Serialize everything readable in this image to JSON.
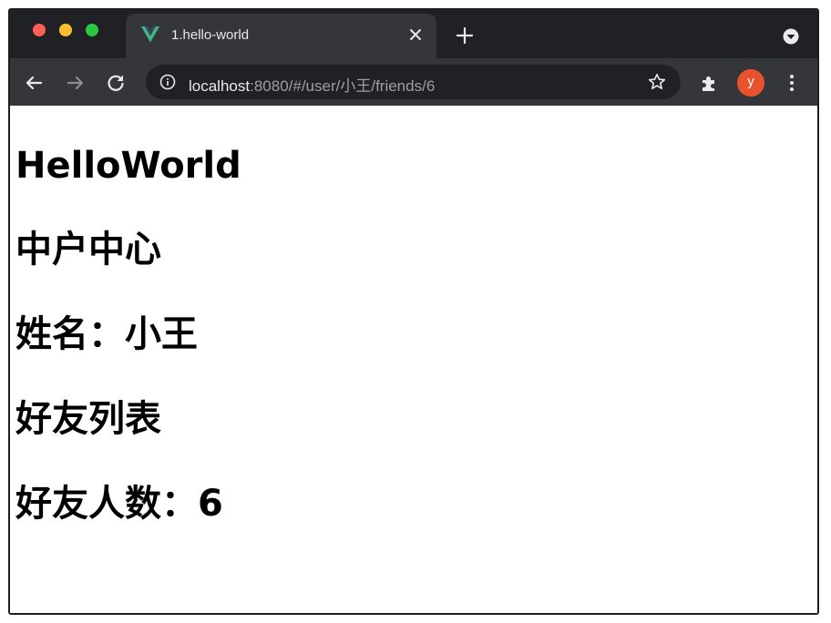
{
  "browser": {
    "tab": {
      "title": "1.hello-world"
    },
    "url": {
      "host": "localhost",
      "rest": ":8080/#/user/小王/friends/6"
    },
    "profile_initial": "y",
    "colors": {
      "vue_green": "#41b883",
      "vue_dark": "#35495e",
      "avatar": "#e8532e"
    }
  },
  "page": {
    "headings": [
      "HelloWorld",
      "中户中心",
      "姓名：小王",
      "好友列表",
      "好友人数：6"
    ]
  }
}
